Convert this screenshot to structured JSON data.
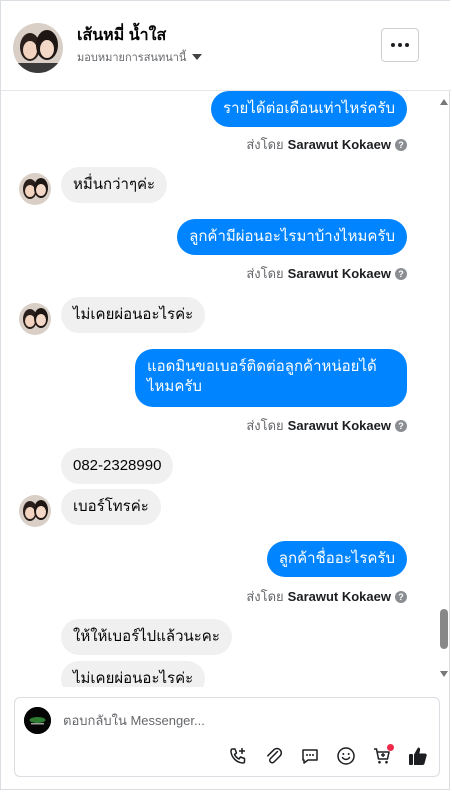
{
  "header": {
    "name": "เส้นหมี่ น้ำใส",
    "assign_label": "มอบหมายการสนทนานี้"
  },
  "messages": [
    {
      "dir": "out",
      "text": "รายได้ต่อเดือนเท่าไหร่ครับ"
    },
    {
      "dir": "meta",
      "prefix": "ส่งโดย",
      "sender": "Sarawut Kokaew"
    },
    {
      "dir": "in",
      "text": "หมื่นกว่าๆค่ะ"
    },
    {
      "dir": "out",
      "text": "ลูกค้ามีผ่อนอะไรมาบ้างไหมครับ"
    },
    {
      "dir": "meta",
      "prefix": "ส่งโดย",
      "sender": "Sarawut Kokaew"
    },
    {
      "dir": "in",
      "text": "ไม่เคยผ่อนอะไรค่ะ"
    },
    {
      "dir": "out",
      "lines": [
        "แอดมินขอเบอร์ติดต่อลูกค้าหน่อยได้",
        "ไหมครับ"
      ]
    },
    {
      "dir": "meta",
      "prefix": "ส่งโดย",
      "sender": "Sarawut Kokaew"
    },
    {
      "dir": "in",
      "text": "082-2328990"
    },
    {
      "dir": "in",
      "text": "เบอร์โทรค่ะ"
    },
    {
      "dir": "out",
      "text": "ลูกค้าชื่ออะไรครับ"
    },
    {
      "dir": "meta",
      "prefix": "ส่งโดย",
      "sender": "Sarawut Kokaew"
    },
    {
      "dir": "in",
      "text": "ให้ให้เบอร์ไปแล้วนะคะ"
    },
    {
      "dir": "in",
      "text": "ไม่เคยผ่อนอะไรค่ะ"
    }
  ],
  "composer": {
    "placeholder": "ตอบกลับใน Messenger..."
  },
  "tools": [
    "phone-add-icon",
    "attachment-icon",
    "saved-replies-icon",
    "emoji-icon",
    "cart-add-icon",
    "like-icon"
  ],
  "colors": {
    "outgoing_bubble": "#0084ff",
    "incoming_bubble": "#f0f0f0",
    "like": "#1c1e21",
    "notification": "#f02849"
  }
}
